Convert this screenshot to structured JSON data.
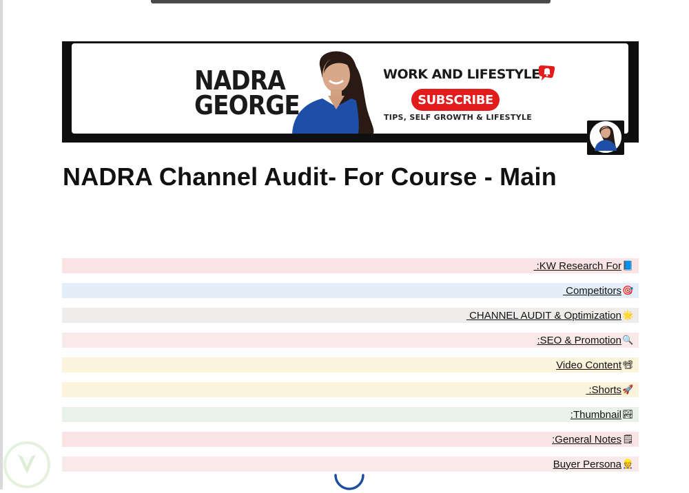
{
  "banner": {
    "brand_line1": "NADRA",
    "brand_line2": "GEORGE",
    "tagline": "WORK AND LIFESTYLE",
    "subscribe_label": "SUBSCRIBE",
    "subtagline": "TIPS, SELF GROWTH &  LIFESTYLE"
  },
  "page": {
    "title": "NADRA Channel Audit- For Course - Main"
  },
  "toc": {
    "items": [
      {
        "label": " :KW Research For",
        "icon": "book-icon",
        "emoji": "📘",
        "bg": "#fbe4e4"
      },
      {
        "label": " Competitors",
        "icon": "target-icon",
        "emoji": "🎯",
        "bg": "#e3eef9"
      },
      {
        "label": " CHANNEL AUDIT & Optimization",
        "icon": "star-icon",
        "emoji": "🌟",
        "bg": "#efedeb"
      },
      {
        "label": ":SEO & Promotion",
        "icon": "magnifier-icon",
        "emoji": "🔍",
        "bg": "#f9e9e8"
      },
      {
        "label": "Video Content",
        "icon": "camera-icon",
        "emoji": "📽",
        "bg": "#fbf3db"
      },
      {
        "label": " :Shorts",
        "icon": "rocket-icon",
        "emoji": "🚀",
        "bg": "#fbf3db"
      },
      {
        "label": ":Thumbnail",
        "icon": "picture-icon",
        "emoji": "🏞",
        "bg": "#e8f2ea"
      },
      {
        "label": ":General Notes",
        "icon": "notepad-icon",
        "emoji": "🗒",
        "bg": "#fbe4e4"
      },
      {
        "label": "Buyer Persona",
        "icon": "person-icon",
        "emoji": "👷",
        "bg": "#f9e9e8"
      }
    ]
  },
  "colors": {
    "subscribe_red": "#e21b1b",
    "spinner_blue": "#1e4f9c",
    "banner_frame": "#0f0f0f"
  }
}
